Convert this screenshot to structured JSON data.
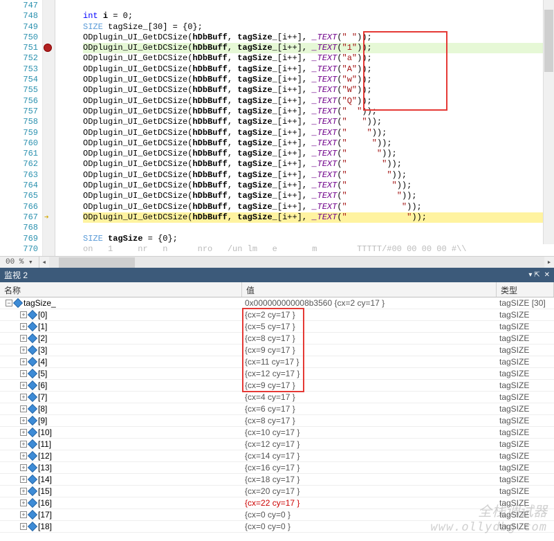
{
  "editor": {
    "zoom_label": "00 %",
    "line_start": 747,
    "lines": [
      {
        "n": 747,
        "html": ""
      },
      {
        "n": 748,
        "html": "<span class='kw'>int</span> <span class='var'>i</span> = 0;"
      },
      {
        "n": 749,
        "html": "<span class='type'>SIZE</span> tagSize_[30] = {0};"
      },
      {
        "n": 750,
        "html": "ODplugin_UI_GetDCSize(<span class='var'>hDbBuff</span>, <span class='var'>tagSize_</span>[i++], <span class='macro'>_TEXT</span>(<span class='str'>\" \"</span>));"
      },
      {
        "n": 751,
        "cls": "hl-green",
        "html": "ODplugin_UI_GetDCSize(<span class='var'>hDbBuff</span>, <span class='var'>tagSize_</span>[i++], <span class='macro'>_TEXT</span>(<span class='str'>\"1\"</span>));"
      },
      {
        "n": 752,
        "html": "ODplugin_UI_GetDCSize(<span class='var'>hDbBuff</span>, <span class='var'>tagSize_</span>[i++], <span class='macro'>_TEXT</span>(<span class='str'>\"a\"</span>));"
      },
      {
        "n": 753,
        "html": "ODplugin_UI_GetDCSize(<span class='var'>hDbBuff</span>, <span class='var'>tagSize_</span>[i++], <span class='macro'>_TEXT</span>(<span class='str'>\"A\"</span>));"
      },
      {
        "n": 754,
        "html": "ODplugin_UI_GetDCSize(<span class='var'>hDbBuff</span>, <span class='var'>tagSize_</span>[i++], <span class='macro'>_TEXT</span>(<span class='str'>\"w\"</span>));"
      },
      {
        "n": 755,
        "html": "ODplugin_UI_GetDCSize(<span class='var'>hDbBuff</span>, <span class='var'>tagSize_</span>[i++], <span class='macro'>_TEXT</span>(<span class='str'>\"W\"</span>));"
      },
      {
        "n": 756,
        "html": "ODplugin_UI_GetDCSize(<span class='var'>hDbBuff</span>, <span class='var'>tagSize_</span>[i++], <span class='macro'>_TEXT</span>(<span class='str'>\"Q\"</span>));"
      },
      {
        "n": 757,
        "html": "ODplugin_UI_GetDCSize(<span class='var'>hDbBuff</span>, <span class='var'>tagSize_</span>[i++], <span class='macro'>_TEXT</span>(<span class='str'>\"  \"</span>));"
      },
      {
        "n": 758,
        "html": "ODplugin_UI_GetDCSize(<span class='var'>hDbBuff</span>, <span class='var'>tagSize_</span>[i++], <span class='macro'>_TEXT</span>(<span class='str'>\"   \"</span>));"
      },
      {
        "n": 759,
        "html": "ODplugin_UI_GetDCSize(<span class='var'>hDbBuff</span>, <span class='var'>tagSize_</span>[i++], <span class='macro'>_TEXT</span>(<span class='str'>\"    \"</span>));"
      },
      {
        "n": 760,
        "html": "ODplugin_UI_GetDCSize(<span class='var'>hDbBuff</span>, <span class='var'>tagSize_</span>[i++], <span class='macro'>_TEXT</span>(<span class='str'>\"     \"</span>));"
      },
      {
        "n": 761,
        "html": "ODplugin_UI_GetDCSize(<span class='var'>hDbBuff</span>, <span class='var'>tagSize_</span>[i++], <span class='macro'>_TEXT</span>(<span class='str'>\"      \"</span>));"
      },
      {
        "n": 762,
        "html": "ODplugin_UI_GetDCSize(<span class='var'>hDbBuff</span>, <span class='var'>tagSize_</span>[i++], <span class='macro'>_TEXT</span>(<span class='str'>\"       \"</span>));"
      },
      {
        "n": 763,
        "html": "ODplugin_UI_GetDCSize(<span class='var'>hDbBuff</span>, <span class='var'>tagSize_</span>[i++], <span class='macro'>_TEXT</span>(<span class='str'>\"        \"</span>));"
      },
      {
        "n": 764,
        "html": "ODplugin_UI_GetDCSize(<span class='var'>hDbBuff</span>, <span class='var'>tagSize_</span>[i++], <span class='macro'>_TEXT</span>(<span class='str'>\"         \"</span>));"
      },
      {
        "n": 765,
        "html": "ODplugin_UI_GetDCSize(<span class='var'>hDbBuff</span>, <span class='var'>tagSize_</span>[i++], <span class='macro'>_TEXT</span>(<span class='str'>\"          \"</span>));"
      },
      {
        "n": 766,
        "html": "ODplugin_UI_GetDCSize(<span class='var'>hDbBuff</span>, <span class='var'>tagSize_</span>[i++], <span class='macro'>_TEXT</span>(<span class='str'>\"           \"</span>));"
      },
      {
        "n": 767,
        "cls": "hl-yellow",
        "html": "ODplugin_UI_GetDCSize(<span class='var'>hDbBuff</span>, <span class='var'>tagSize_</span>[i++], <span class='macro'>_TEXT</span>(<span class='str'>\"            \"</span>));"
      },
      {
        "n": 768,
        "html": ""
      },
      {
        "n": 769,
        "html": "<span class='type'>SIZE</span> <span class='var'>tagSize</span> = {0};"
      },
      {
        "n": 770,
        "html": "<span style='color:#bbb'>on   1     nr   n      nro   /un lm   e       m        TTTTT/#00 00 00 00 #\\\\</span>"
      }
    ]
  },
  "panel": {
    "title": "监视 2",
    "pin_symbol": "▾ ⇱",
    "close_symbol": "✕"
  },
  "watch": {
    "headers": {
      "name": "名称",
      "value": "值",
      "type": "类型"
    },
    "root": {
      "name": "tagSize_",
      "value": "0x000000000008b3560 {cx=2 cy=17 }",
      "type": "tagSIZE [30]"
    },
    "rows": [
      {
        "idx": "[0]",
        "val": "{cx=2 cy=17 }",
        "type": "tagSIZE"
      },
      {
        "idx": "[1]",
        "val": "{cx=5 cy=17 }",
        "type": "tagSIZE"
      },
      {
        "idx": "[2]",
        "val": "{cx=8 cy=17 }",
        "type": "tagSIZE"
      },
      {
        "idx": "[3]",
        "val": "{cx=9 cy=17 }",
        "type": "tagSIZE"
      },
      {
        "idx": "[4]",
        "val": "{cx=11 cy=17 }",
        "type": "tagSIZE"
      },
      {
        "idx": "[5]",
        "val": "{cx=12 cy=17 }",
        "type": "tagSIZE"
      },
      {
        "idx": "[6]",
        "val": "{cx=9 cy=17 }",
        "type": "tagSIZE"
      },
      {
        "idx": "[7]",
        "val": "{cx=4 cy=17 }",
        "type": "tagSIZE"
      },
      {
        "idx": "[8]",
        "val": "{cx=6 cy=17 }",
        "type": "tagSIZE"
      },
      {
        "idx": "[9]",
        "val": "{cx=8 cy=17 }",
        "type": "tagSIZE"
      },
      {
        "idx": "[10]",
        "val": "{cx=10 cy=17 }",
        "type": "tagSIZE"
      },
      {
        "idx": "[11]",
        "val": "{cx=12 cy=17 }",
        "type": "tagSIZE"
      },
      {
        "idx": "[12]",
        "val": "{cx=14 cy=17 }",
        "type": "tagSIZE"
      },
      {
        "idx": "[13]",
        "val": "{cx=16 cy=17 }",
        "type": "tagSIZE"
      },
      {
        "idx": "[14]",
        "val": "{cx=18 cy=17 }",
        "type": "tagSIZE"
      },
      {
        "idx": "[15]",
        "val": "{cx=20 cy=17 }",
        "type": "tagSIZE"
      },
      {
        "idx": "[16]",
        "val": "{cx=22 cy=17 }",
        "type": "tagSIZE",
        "red": true
      },
      {
        "idx": "[17]",
        "val": "{cx=0 cy=0 }",
        "type": "tagSIZE"
      },
      {
        "idx": "[18]",
        "val": "{cx=0 cy=0 }",
        "type": "tagSIZE"
      }
    ]
  },
  "watermark": {
    "line1": "全栈调试器",
    "line2": "www.ollydbg.com"
  }
}
